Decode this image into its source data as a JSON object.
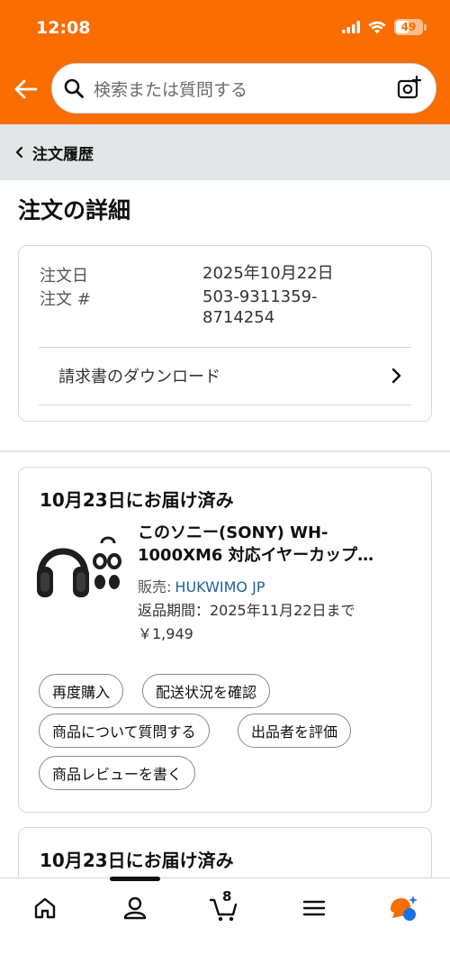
{
  "status_bar": {
    "time": "12:08",
    "battery": "49"
  },
  "search": {
    "placeholder": "検索または質問する"
  },
  "breadcrumb": {
    "label": "注文履歴"
  },
  "page_title": "注文の詳細",
  "order_info": {
    "date_label": "注文日",
    "date_value": "2025年10月22日",
    "number_label": "注文 #",
    "number_value_line1": "503-9311359-",
    "number_value_line2": "8714254",
    "invoice_label": "請求書のダウンロード"
  },
  "shipment": {
    "status": "10月23日にお届け済み",
    "product_title_line1": "このソニー(SONY) WH-",
    "product_title_line2": "1000XM6 対応イヤーカップ…",
    "seller_prefix": "販売:",
    "seller_name": "HUKWIMO JP",
    "return_period": "返品期間：2025年11月22日まで",
    "price": "￥1,949",
    "actions": {
      "buy_again": "再度購入",
      "track": "配送状況を確認",
      "ask": "商品について質問する",
      "rate_seller": "出品者を評価",
      "review": "商品レビューを書く"
    }
  },
  "shipment2": {
    "status": "10月23日にお届け済み"
  },
  "bottom_nav": {
    "cart_count": "8",
    "items": [
      "home-icon",
      "account-icon",
      "cart-icon",
      "menu-icon",
      "rufus-icon"
    ]
  },
  "colors": {
    "brand_orange": "#fa6d00",
    "link_blue": "#2162a1"
  }
}
